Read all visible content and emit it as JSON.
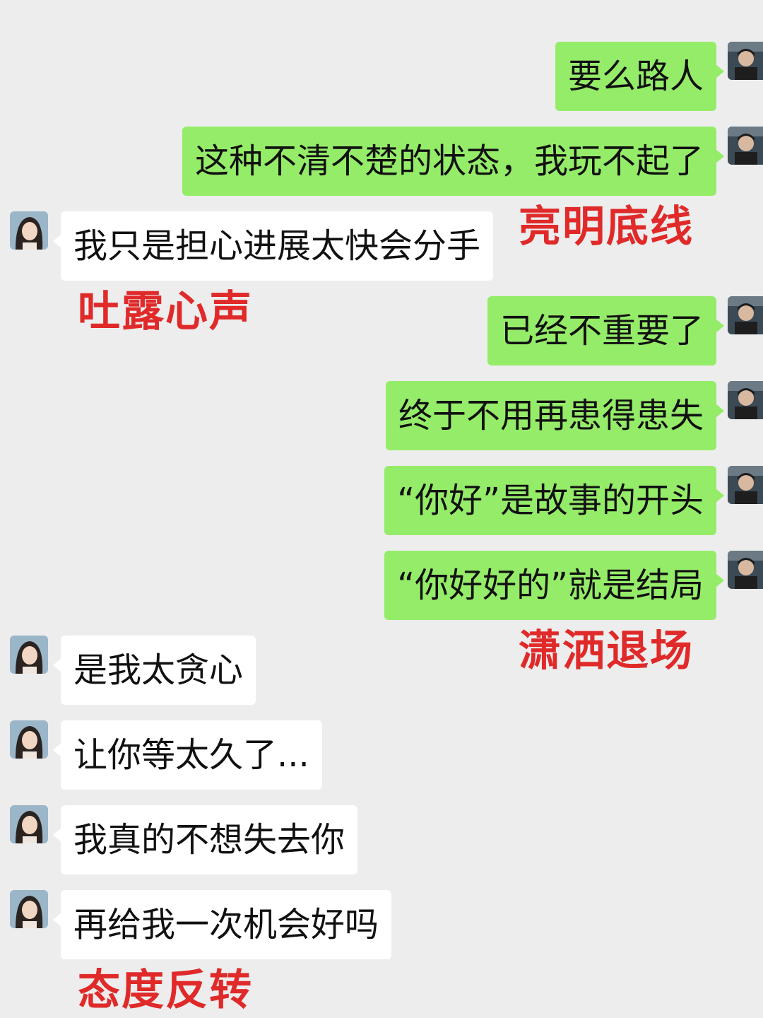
{
  "messages": [
    {
      "side": "right",
      "text": "要么路人"
    },
    {
      "side": "right",
      "text": "这种不清不楚的状态，我玩不起了"
    },
    {
      "side": "left",
      "text": "我只是担心进展太快会分手"
    },
    {
      "side": "right",
      "text": "已经不重要了"
    },
    {
      "side": "right",
      "text": "终于不用再患得患失"
    },
    {
      "side": "right",
      "text": "“你好”是故事的开头"
    },
    {
      "side": "right",
      "text": "“你好好的”就是结局"
    },
    {
      "side": "left",
      "text": "是我太贪心"
    },
    {
      "side": "left",
      "text": "让你等太久了..."
    },
    {
      "side": "left",
      "text": "我真的不想失去你"
    },
    {
      "side": "left",
      "text": "再给我一次机会好吗"
    }
  ],
  "annotations": [
    {
      "text": "亮明底线"
    },
    {
      "text": "吐露心声"
    },
    {
      "text": "潇洒退场"
    },
    {
      "text": "态度反转"
    }
  ],
  "colors": {
    "background": "#ededed",
    "sent_bubble": "#95ec69",
    "received_bubble": "#ffffff",
    "annotation": "#e02a2a"
  },
  "icons": {
    "sender_avatar": "avatar-man-icon",
    "receiver_avatar": "avatar-woman-icon"
  }
}
